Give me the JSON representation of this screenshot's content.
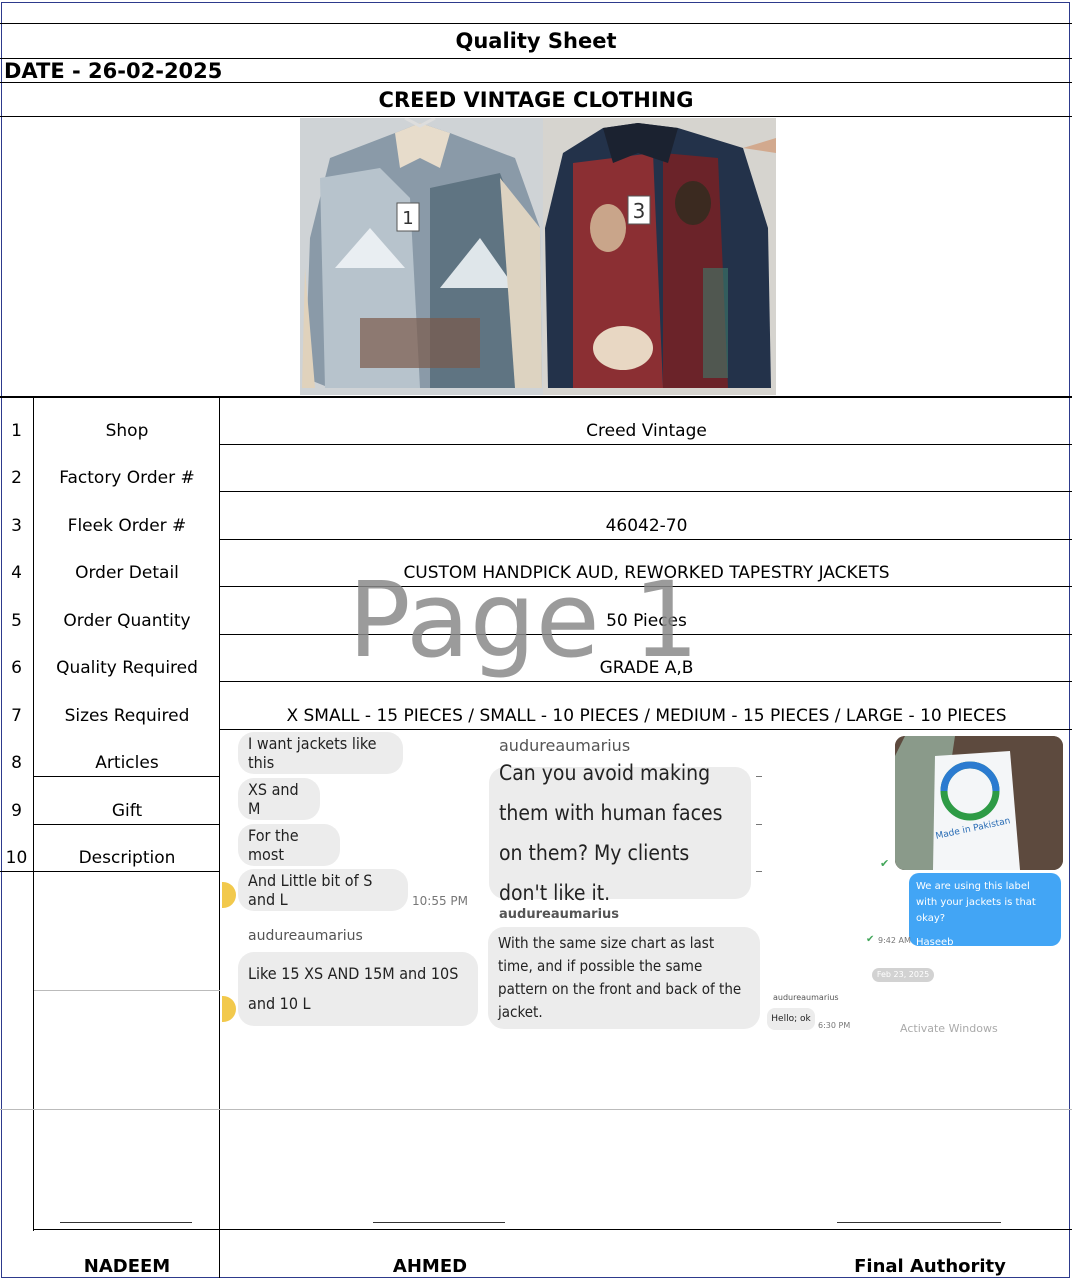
{
  "sheet": {
    "title": "Quality Sheet",
    "date": "DATE - 26-02-2025",
    "brand": "CREED VINTAGE CLOTHING",
    "watermark": "Page 1"
  },
  "photos": {
    "left_tag": "1",
    "right_tag": "3"
  },
  "rows": [
    {
      "num": "1",
      "label": "Shop",
      "value": "Creed Vintage"
    },
    {
      "num": "2",
      "label": "Factory Order #",
      "value": ""
    },
    {
      "num": "3",
      "label": "Fleek Order #",
      "value": "46042-70"
    },
    {
      "num": "4",
      "label": "Order Detail",
      "value": "CUSTOM HANDPICK AUD, REWORKED TAPESTRY JACKETS"
    },
    {
      "num": "5",
      "label": "Order Quantity",
      "value": "50 Pieces"
    },
    {
      "num": "6",
      "label": "Quality Required",
      "value": "GRADE A,B"
    },
    {
      "num": "7",
      "label": "Sizes Required",
      "value": "X SMALL - 15 PIECES / SMALL - 10 PIECES / MEDIUM - 15 PIECES / LARGE - 10 PIECES"
    },
    {
      "num": "8",
      "label": "Articles",
      "value": ""
    },
    {
      "num": "9",
      "label": "Gift",
      "value": ""
    },
    {
      "num": "10",
      "label": "Description",
      "value": ""
    }
  ],
  "chat": {
    "left": {
      "bubbles": [
        "I want jackets like this",
        "XS and M",
        "For the most",
        "And Little bit of S and L"
      ],
      "time": "10:55 PM",
      "sender": "audureaumarius",
      "bubble_last": "Like 15 XS AND 15M and 10S and 10 L"
    },
    "middle": {
      "sender1": "audureaumarius",
      "bubble1": "Can you avoid making them with human faces on them? My clients don't like it.",
      "sender2": "audureaumarius",
      "bubble2": "With the same size chart as last time, and if possible the same pattern on the front and back of the jacket."
    },
    "right": {
      "label_text": "Made in Pakistan",
      "blue_message": "We are using this label with your jackets is that okay?",
      "blue_signature": "Haseeb",
      "time1": "9:42 AM",
      "date_chip": "Feb 23, 2025",
      "sender": "audureaumarius",
      "reply": "Hello; ok",
      "time2": "6:30 PM",
      "activate": "Activate Windows"
    }
  },
  "signatures": {
    "left": "NADEEM",
    "middle": "AHMED",
    "right": "Final Authority"
  },
  "colors": {
    "blue_bubble": "#42a5f5",
    "bubble_gray": "#ececec",
    "reaction": "#f2c94c",
    "watermark": "#8a8a8a"
  }
}
